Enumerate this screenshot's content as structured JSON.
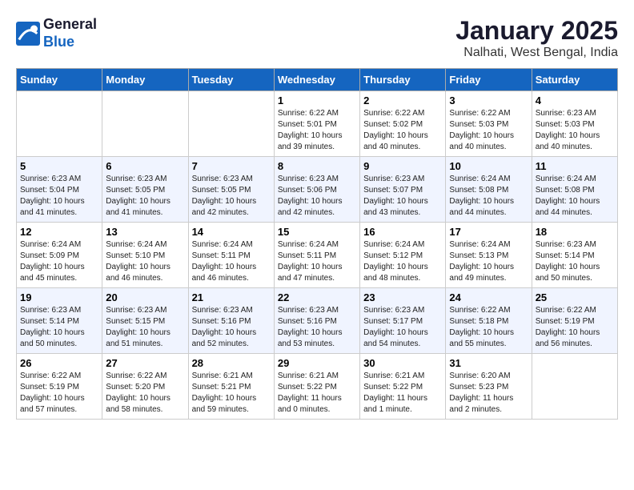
{
  "logo": {
    "text_general": "General",
    "text_blue": "Blue"
  },
  "title": "January 2025",
  "subtitle": "Nalhati, West Bengal, India",
  "weekdays": [
    "Sunday",
    "Monday",
    "Tuesday",
    "Wednesday",
    "Thursday",
    "Friday",
    "Saturday"
  ],
  "weeks": [
    {
      "row_class": "normal-row",
      "days": [
        {
          "number": "",
          "info": ""
        },
        {
          "number": "",
          "info": ""
        },
        {
          "number": "",
          "info": ""
        },
        {
          "number": "1",
          "info": "Sunrise: 6:22 AM\nSunset: 5:01 PM\nDaylight: 10 hours and 39 minutes."
        },
        {
          "number": "2",
          "info": "Sunrise: 6:22 AM\nSunset: 5:02 PM\nDaylight: 10 hours and 40 minutes."
        },
        {
          "number": "3",
          "info": "Sunrise: 6:22 AM\nSunset: 5:03 PM\nDaylight: 10 hours and 40 minutes."
        },
        {
          "number": "4",
          "info": "Sunrise: 6:23 AM\nSunset: 5:03 PM\nDaylight: 10 hours and 40 minutes."
        }
      ]
    },
    {
      "row_class": "alt-row",
      "days": [
        {
          "number": "5",
          "info": "Sunrise: 6:23 AM\nSunset: 5:04 PM\nDaylight: 10 hours and 41 minutes."
        },
        {
          "number": "6",
          "info": "Sunrise: 6:23 AM\nSunset: 5:05 PM\nDaylight: 10 hours and 41 minutes."
        },
        {
          "number": "7",
          "info": "Sunrise: 6:23 AM\nSunset: 5:05 PM\nDaylight: 10 hours and 42 minutes."
        },
        {
          "number": "8",
          "info": "Sunrise: 6:23 AM\nSunset: 5:06 PM\nDaylight: 10 hours and 42 minutes."
        },
        {
          "number": "9",
          "info": "Sunrise: 6:23 AM\nSunset: 5:07 PM\nDaylight: 10 hours and 43 minutes."
        },
        {
          "number": "10",
          "info": "Sunrise: 6:24 AM\nSunset: 5:08 PM\nDaylight: 10 hours and 44 minutes."
        },
        {
          "number": "11",
          "info": "Sunrise: 6:24 AM\nSunset: 5:08 PM\nDaylight: 10 hours and 44 minutes."
        }
      ]
    },
    {
      "row_class": "normal-row",
      "days": [
        {
          "number": "12",
          "info": "Sunrise: 6:24 AM\nSunset: 5:09 PM\nDaylight: 10 hours and 45 minutes."
        },
        {
          "number": "13",
          "info": "Sunrise: 6:24 AM\nSunset: 5:10 PM\nDaylight: 10 hours and 46 minutes."
        },
        {
          "number": "14",
          "info": "Sunrise: 6:24 AM\nSunset: 5:11 PM\nDaylight: 10 hours and 46 minutes."
        },
        {
          "number": "15",
          "info": "Sunrise: 6:24 AM\nSunset: 5:11 PM\nDaylight: 10 hours and 47 minutes."
        },
        {
          "number": "16",
          "info": "Sunrise: 6:24 AM\nSunset: 5:12 PM\nDaylight: 10 hours and 48 minutes."
        },
        {
          "number": "17",
          "info": "Sunrise: 6:24 AM\nSunset: 5:13 PM\nDaylight: 10 hours and 49 minutes."
        },
        {
          "number": "18",
          "info": "Sunrise: 6:23 AM\nSunset: 5:14 PM\nDaylight: 10 hours and 50 minutes."
        }
      ]
    },
    {
      "row_class": "alt-row",
      "days": [
        {
          "number": "19",
          "info": "Sunrise: 6:23 AM\nSunset: 5:14 PM\nDaylight: 10 hours and 50 minutes."
        },
        {
          "number": "20",
          "info": "Sunrise: 6:23 AM\nSunset: 5:15 PM\nDaylight: 10 hours and 51 minutes."
        },
        {
          "number": "21",
          "info": "Sunrise: 6:23 AM\nSunset: 5:16 PM\nDaylight: 10 hours and 52 minutes."
        },
        {
          "number": "22",
          "info": "Sunrise: 6:23 AM\nSunset: 5:16 PM\nDaylight: 10 hours and 53 minutes."
        },
        {
          "number": "23",
          "info": "Sunrise: 6:23 AM\nSunset: 5:17 PM\nDaylight: 10 hours and 54 minutes."
        },
        {
          "number": "24",
          "info": "Sunrise: 6:22 AM\nSunset: 5:18 PM\nDaylight: 10 hours and 55 minutes."
        },
        {
          "number": "25",
          "info": "Sunrise: 6:22 AM\nSunset: 5:19 PM\nDaylight: 10 hours and 56 minutes."
        }
      ]
    },
    {
      "row_class": "normal-row",
      "days": [
        {
          "number": "26",
          "info": "Sunrise: 6:22 AM\nSunset: 5:19 PM\nDaylight: 10 hours and 57 minutes."
        },
        {
          "number": "27",
          "info": "Sunrise: 6:22 AM\nSunset: 5:20 PM\nDaylight: 10 hours and 58 minutes."
        },
        {
          "number": "28",
          "info": "Sunrise: 6:21 AM\nSunset: 5:21 PM\nDaylight: 10 hours and 59 minutes."
        },
        {
          "number": "29",
          "info": "Sunrise: 6:21 AM\nSunset: 5:22 PM\nDaylight: 11 hours and 0 minutes."
        },
        {
          "number": "30",
          "info": "Sunrise: 6:21 AM\nSunset: 5:22 PM\nDaylight: 11 hours and 1 minute."
        },
        {
          "number": "31",
          "info": "Sunrise: 6:20 AM\nSunset: 5:23 PM\nDaylight: 11 hours and 2 minutes."
        },
        {
          "number": "",
          "info": ""
        }
      ]
    }
  ]
}
